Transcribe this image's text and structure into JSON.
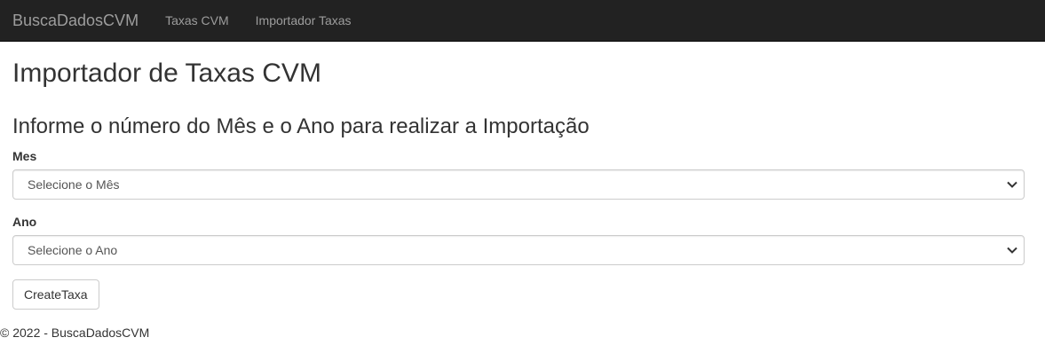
{
  "navbar": {
    "brand": "BuscaDadosCVM",
    "links": [
      {
        "label": "Taxas CVM"
      },
      {
        "label": "Importador Taxas"
      }
    ]
  },
  "page": {
    "title": "Importador de Taxas CVM",
    "subtitle": "Informe o número do Mês e o Ano para realizar a Importação"
  },
  "form": {
    "month": {
      "label": "Mes",
      "selected": "Selecione o Mês"
    },
    "year": {
      "label": "Ano",
      "selected": "Selecione o Ano"
    },
    "submit_label": "CreateTaxa"
  },
  "footer": {
    "text": "© 2022 - BuscaDadosCVM"
  },
  "colors": {
    "navbar_bg": "#222222",
    "nav_text": "#9d9d9d",
    "body_text": "#333333",
    "border": "#cccccc"
  }
}
